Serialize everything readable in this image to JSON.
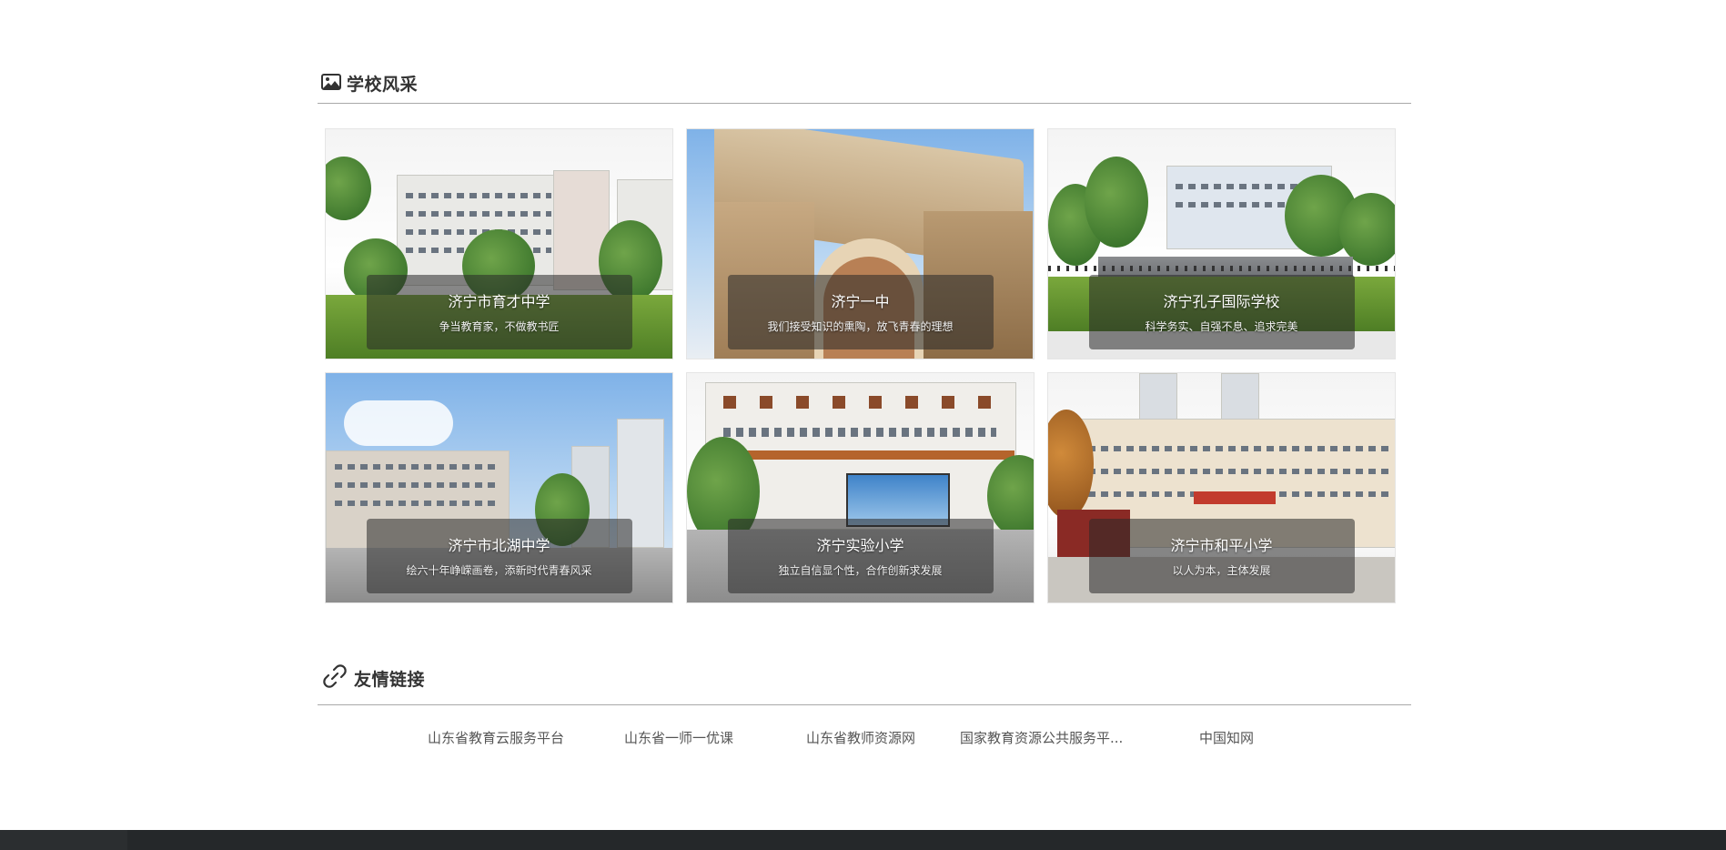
{
  "school_section": {
    "title": "学校风采",
    "icon": "picture-icon"
  },
  "schools": [
    {
      "name": "济宁市育才中学",
      "slogan": "争当教育家，不做教书匠"
    },
    {
      "name": "济宁一中",
      "slogan": "我们接受知识的熏陶，放飞青春的理想"
    },
    {
      "name": "济宁孔子国际学校",
      "slogan": "科学务实、自强不息、追求完美"
    },
    {
      "name": "济宁市北湖中学",
      "slogan": "绘六十年峥嵘画卷，添新时代青春风采"
    },
    {
      "name": "济宁实验小学",
      "slogan": "独立自信显个性，合作创新求发展"
    },
    {
      "name": "济宁市和平小学",
      "slogan": "以人为本，主体发展"
    }
  ],
  "links_section": {
    "title": "友情链接",
    "icon": "link-icon"
  },
  "links": [
    "山东省教育云服务平台",
    "山东省一师一优课",
    "山东省教师资源网",
    "国家教育资源公共服务平...",
    "中国知网"
  ],
  "colors": {
    "divider": "#a9a9a9",
    "footer": "#25282a",
    "overlay": "rgba(40,40,40,0.55)"
  }
}
